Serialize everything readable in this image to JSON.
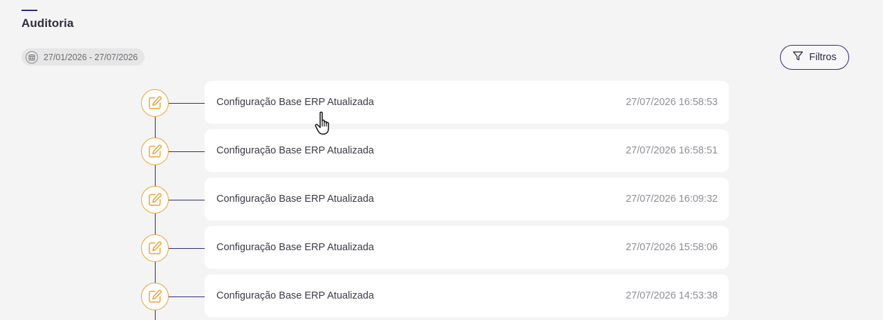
{
  "page": {
    "title": "Auditoria"
  },
  "date_range": {
    "icon": "calendar-icon",
    "label": "27/01/2026 - 27/07/2026"
  },
  "filters_button": {
    "icon": "filter-icon",
    "label": "Filtros"
  },
  "audit_entries": [
    {
      "icon": "edit-icon",
      "title": "Configuração Base ERP Atualizada",
      "timestamp": "27/07/2026 16:58:53"
    },
    {
      "icon": "edit-icon",
      "title": "Configuração Base ERP Atualizada",
      "timestamp": "27/07/2026 16:58:51"
    },
    {
      "icon": "edit-icon",
      "title": "Configuração Base ERP Atualizada",
      "timestamp": "27/07/2026 16:09:32"
    },
    {
      "icon": "edit-icon",
      "title": "Configuração Base ERP Atualizada",
      "timestamp": "27/07/2026 15:58:06"
    },
    {
      "icon": "edit-icon",
      "title": "Configuração Base ERP Atualizada",
      "timestamp": "27/07/2026 14:53:38"
    }
  ],
  "colors": {
    "accent": "#2b2a7c",
    "icon_orange": "#f0a030",
    "background": "#f4f4f4",
    "card": "#ffffff"
  }
}
